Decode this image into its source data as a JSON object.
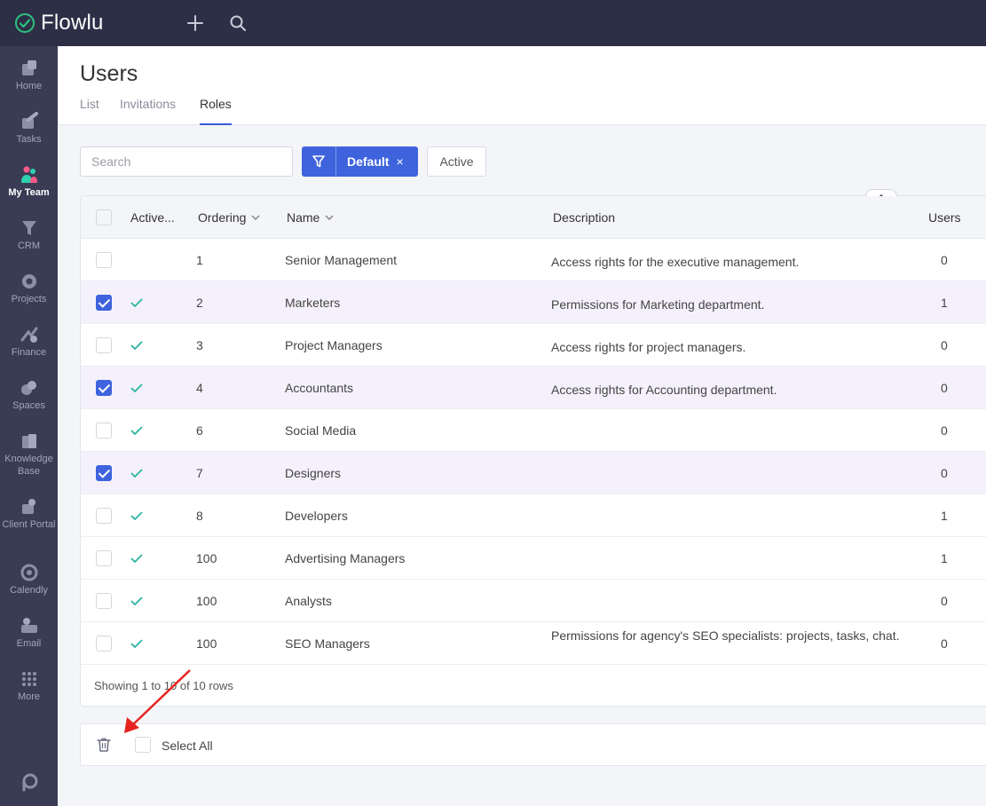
{
  "app": {
    "name": "Flowlu"
  },
  "topbar": {
    "add_icon": "plus-icon",
    "search_icon": "search-icon"
  },
  "sidebar": {
    "items": [
      {
        "label": "Home",
        "icon": "home-icon"
      },
      {
        "label": "Tasks",
        "icon": "tasks-icon"
      },
      {
        "label": "My Team",
        "icon": "team-icon",
        "active": true
      },
      {
        "label": "CRM",
        "icon": "crm-icon"
      },
      {
        "label": "Projects",
        "icon": "projects-icon"
      },
      {
        "label": "Finance",
        "icon": "finance-icon"
      },
      {
        "label": "Spaces",
        "icon": "spaces-icon"
      },
      {
        "label": "Knowledge Base",
        "icon": "knowledge-base-icon"
      },
      {
        "label": "Client Portal",
        "icon": "client-portal-icon"
      },
      {
        "label": "Calendly",
        "icon": "calendly-icon"
      },
      {
        "label": "Email",
        "icon": "email-icon"
      },
      {
        "label": "More",
        "icon": "more-icon"
      }
    ],
    "bottom_icon": "flowlu-brand-icon"
  },
  "page": {
    "title": "Users",
    "tabs": [
      {
        "label": "List"
      },
      {
        "label": "Invitations"
      },
      {
        "label": "Roles",
        "active": true
      }
    ]
  },
  "toolbar": {
    "search_placeholder": "Search",
    "filter_label": "Default",
    "filter_clear": "×",
    "active_label": "Active"
  },
  "table": {
    "columns": {
      "active": "Active...",
      "ordering": "Ordering",
      "name": "Name",
      "description": "Description",
      "users": "Users"
    },
    "rows": [
      {
        "checked": false,
        "active": false,
        "ordering": "1",
        "name": "Senior Management",
        "description": "Access rights for the executive management.",
        "users": "0"
      },
      {
        "checked": true,
        "active": true,
        "ordering": "2",
        "name": "Marketers",
        "description": "Permissions for Marketing department.",
        "users": "1"
      },
      {
        "checked": false,
        "active": true,
        "ordering": "3",
        "name": "Project Managers",
        "description": "Access rights for project managers.",
        "users": "0"
      },
      {
        "checked": true,
        "active": true,
        "ordering": "4",
        "name": "Accountants",
        "description": "Access rights for Accounting department.",
        "users": "0"
      },
      {
        "checked": false,
        "active": true,
        "ordering": "6",
        "name": "Social Media",
        "description": "",
        "users": "0"
      },
      {
        "checked": true,
        "active": true,
        "ordering": "7",
        "name": "Designers",
        "description": "",
        "users": "0"
      },
      {
        "checked": false,
        "active": true,
        "ordering": "8",
        "name": "Developers",
        "description": "",
        "users": "1"
      },
      {
        "checked": false,
        "active": true,
        "ordering": "100",
        "name": "Advertising Managers",
        "description": "",
        "users": "1"
      },
      {
        "checked": false,
        "active": true,
        "ordering": "100",
        "name": "Analysts",
        "description": "",
        "users": "0"
      },
      {
        "checked": false,
        "active": true,
        "ordering": "100",
        "name": "SEO Managers",
        "description": "Permissions for agency's SEO specialists: projects, tasks, chat.",
        "users": "0"
      }
    ],
    "footer": "Showing 1 to 10 of 10 rows"
  },
  "bulk": {
    "select_all_label": "Select All",
    "delete_icon": "trash-icon"
  },
  "colors": {
    "topbar": "#2d2f47",
    "sidebar": "#3a3c56",
    "accent": "#3e63dd",
    "check": "#2bb5a0",
    "annotation": "#e8231f"
  }
}
